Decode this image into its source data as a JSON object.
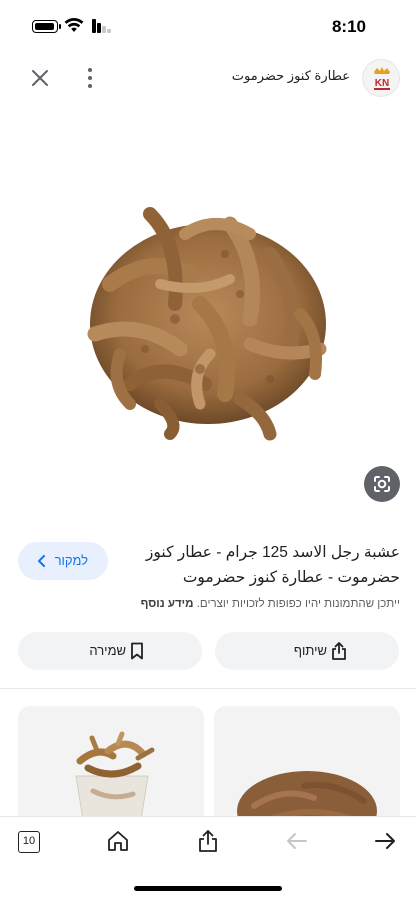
{
  "status_bar": {
    "time": "8:10",
    "icons": [
      "battery-icon",
      "wifi-icon",
      "cellular-signal-icon"
    ]
  },
  "header": {
    "source_name": "عطارة كنوز حضرموت",
    "logo_text": "KN",
    "icons": [
      "close-icon",
      "more-vert-icon"
    ]
  },
  "image": {
    "description_icon": "google-lens-icon"
  },
  "info": {
    "title": "عشبة رجل الاسد 125 جرام - عطار كنوز حضرموت - عطارة كنوز حضرموت",
    "visit_label": "למקור",
    "disclaimer": "ייתכן שהתמונות יהיו כפופות לזכויות יוצרים.",
    "learn_more": "מידע נוסף"
  },
  "actions": {
    "share_label": "שיתוף",
    "save_label": "שמירה"
  },
  "bottom_bar": {
    "tab_count": "10",
    "icons": [
      "tabs-icon",
      "home-icon",
      "share-icon",
      "back-arrow-icon",
      "forward-arrow-icon"
    ]
  },
  "colors": {
    "accent": "#1a73e8",
    "visit_bg": "#e8f0fe",
    "pill_bg": "#f1f3f4",
    "lens_bg": "#5f6368"
  }
}
